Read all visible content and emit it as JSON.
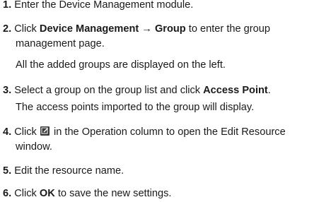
{
  "steps": [
    {
      "num": "1.",
      "text": "Enter the Device Management module."
    },
    {
      "num": "2.",
      "pre": "Click ",
      "bold": "Device Management → Group",
      "post": " to enter the group",
      "cont": "management page.",
      "result": "All the added groups are displayed on the left."
    },
    {
      "num": "3.",
      "pre": "Select a group on the group list and click ",
      "bold": "Access Point",
      "post": ".",
      "result": "The access points imported to the group will display."
    },
    {
      "num": "4.",
      "pre": "Click ",
      "icon": "edit-icon",
      "post": " in the Operation column to open the Edit Resource",
      "cont": "window."
    },
    {
      "num": "5.",
      "text": "Edit the resource name."
    },
    {
      "num": "6.",
      "pre": "Click ",
      "bold": "OK",
      "post": " to save the new settings."
    }
  ]
}
